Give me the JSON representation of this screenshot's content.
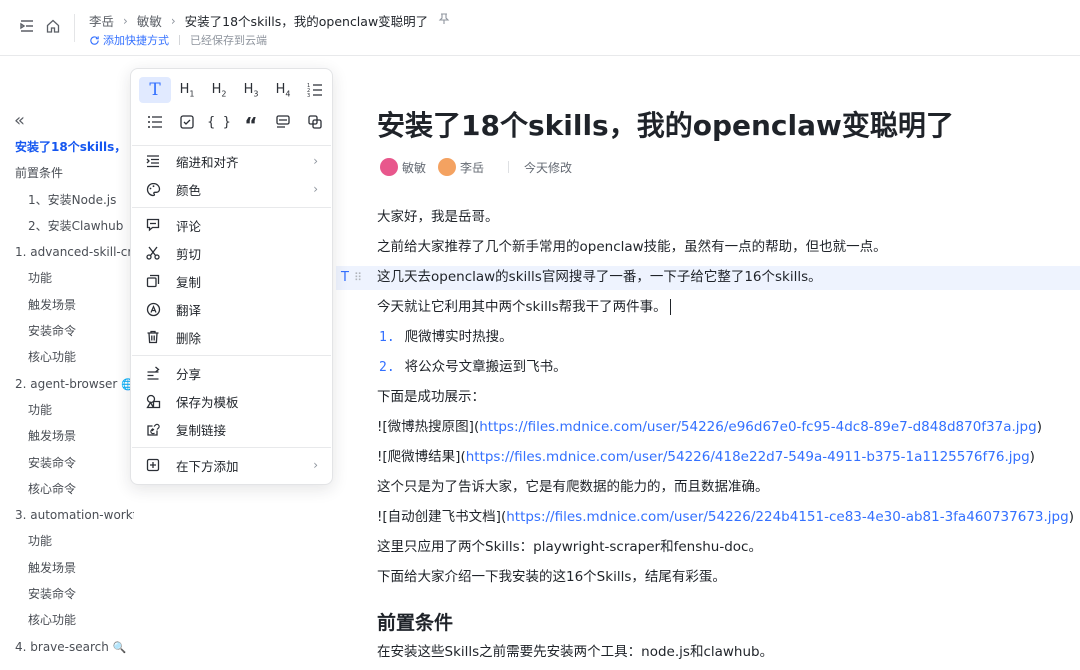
{
  "header": {
    "breadcrumbs": [
      "李岳",
      "敏敏",
      "安装了18个skills，我的openclaw变聪明了"
    ],
    "shortcut_label": "添加快捷方式",
    "saved_status": "已经保存到云端"
  },
  "sidebar": {
    "collapse_glyph": "«",
    "items": [
      {
        "label": "安装了18个skills，",
        "level": 0,
        "active": true
      },
      {
        "label": "前置条件",
        "level": 0
      },
      {
        "label": "1、安装Node.js",
        "level": 1
      },
      {
        "label": "2、安装Clawhub",
        "level": 1
      },
      {
        "label": "1. advanced-skill-creator",
        "level": 0
      },
      {
        "label": "功能",
        "level": 1
      },
      {
        "label": "触发场景",
        "level": 1
      },
      {
        "label": "安装命令",
        "level": 1
      },
      {
        "label": "核心功能",
        "level": 1
      },
      {
        "label": "2. agent-browser",
        "level": 0,
        "emoji": "🌐"
      },
      {
        "label": "功能",
        "level": 1
      },
      {
        "label": "触发场景",
        "level": 1
      },
      {
        "label": "安装命令",
        "level": 1
      },
      {
        "label": "核心命令",
        "level": 1
      },
      {
        "label": "3. automation-workflows",
        "level": 0,
        "emoji": "😈"
      },
      {
        "label": "功能",
        "level": 1
      },
      {
        "label": "触发场景",
        "level": 1
      },
      {
        "label": "安装命令",
        "level": 1
      },
      {
        "label": "核心功能",
        "level": 1
      },
      {
        "label": "4. brave-search",
        "level": 0,
        "emoji": "🔍"
      }
    ]
  },
  "menu": {
    "format_row1": [
      "T",
      "H1",
      "H2",
      "H3",
      "H4",
      "ordered-list"
    ],
    "format_row2": [
      "bullet-list",
      "checkbox",
      "{ }",
      "quote",
      "callout",
      "sync-block"
    ],
    "items": {
      "indent": "缩进和对齐",
      "color": "颜色",
      "comment": "评论",
      "cut": "剪切",
      "copy": "复制",
      "translate": "翻译",
      "delete": "删除",
      "share": "分享",
      "save_template": "保存为模板",
      "copy_link": "复制链接",
      "add_below": "在下方添加"
    }
  },
  "doc": {
    "title": "安装了18个skills，我的openclaw变聪明了",
    "authors": [
      "敏敏",
      "李岳"
    ],
    "modified": "今天修改",
    "p1": "大家好，我是岳哥。",
    "p2": "之前给大家推荐了几个新手常用的openclaw技能，虽然有一点的帮助，但也就一点。",
    "p3": "这几天去openclaw的skills官网搜寻了一番，一下子给它整了16个skills。",
    "p4": "今天就让它利用其中两个skills帮我干了两件事。",
    "list": [
      {
        "num": "1.",
        "text": "爬微博实时热搜。"
      },
      {
        "num": "2.",
        "text": "将公众号文章搬运到飞书。"
      }
    ],
    "p5": "下面是成功展示：",
    "img1_alt": "![微博热搜原图](",
    "img1_url": "https://files.mdnice.com/user/54226/e96d67e0-fc95-4dc8-89e7-d848d870f37a.jpg",
    "img2_alt": "![爬微博结果](",
    "img2_url": "https://files.mdnice.com/user/54226/418e22d7-549a-4911-b375-1a1125576f76.jpg",
    "p6": "这个只是为了告诉大家，它是有爬数据的能力的，而且数据准确。",
    "img3_alt": "![自动创建飞书文档](",
    "img3_url": "https://files.mdnice.com/user/54226/224b4151-ce83-4e30-ab81-3fa460737673.jpg",
    "p7": "这里只应用了两个Skills：playwright-scraper和fenshu-doc。",
    "p8": "下面给大家介绍一下我安装的这16个Skills，结尾有彩蛋。",
    "h2": "前置条件",
    "p9": "在安装这些Skills之前需要先安装两个工具：node.js和clawhub。"
  },
  "colors": {
    "accent": "#3370ff",
    "active_outline": "#1456f0",
    "highlight_row": "#eef3fe",
    "avatar1": "#e8578c",
    "avatar2": "#f4a261"
  }
}
